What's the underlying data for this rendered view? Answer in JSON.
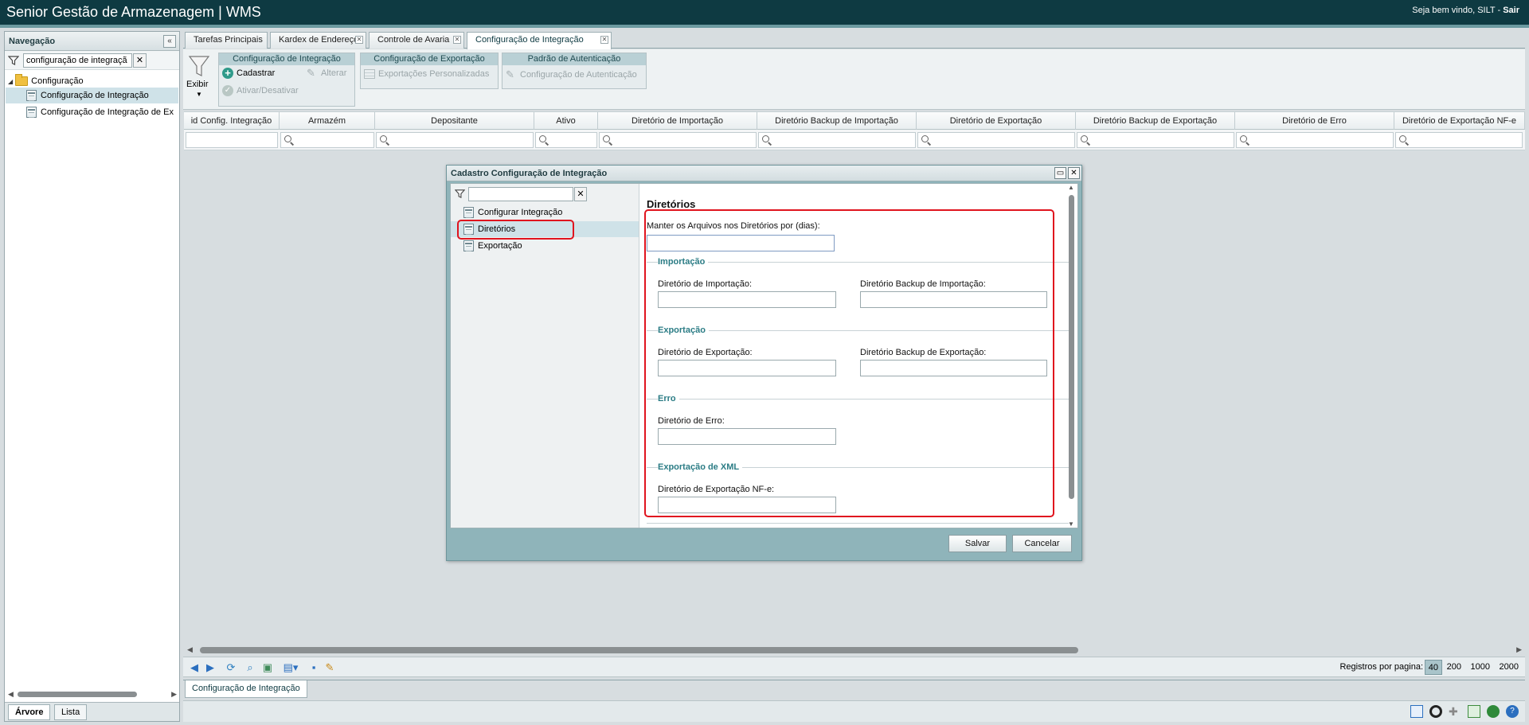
{
  "topbar": {
    "app_title": "Senior Gestão de Armazenagem | WMS",
    "welcome": "Seja bem vindo, SILT - ",
    "logout": "Sair"
  },
  "nav": {
    "title": "Navegação",
    "filter_value": "configuração de integraçã",
    "tree": {
      "root": "Configuração",
      "items": [
        "Configuração de Integração",
        "Configuração de Integração de Ex"
      ]
    },
    "bottom_tabs": [
      "Árvore",
      "Lista"
    ]
  },
  "tabs": [
    {
      "label": "Tarefas Principais",
      "closable": false
    },
    {
      "label": "Kardex de Endereço",
      "closable": true
    },
    {
      "label": "Controle de Avaria",
      "closable": true
    },
    {
      "label": "Configuração de Integração",
      "closable": true,
      "active": true
    }
  ],
  "ribbon": {
    "exibir": "Exibir",
    "groups": [
      {
        "title": "Configuração de Integração",
        "items": [
          "Cadastrar",
          "Alterar",
          "Ativar/Desativar"
        ]
      },
      {
        "title": "Configuração de Exportação",
        "items": [
          "Exportações Personalizadas"
        ]
      },
      {
        "title": "Padrão de Autenticação",
        "items": [
          "Configuração de Autenticação"
        ]
      }
    ]
  },
  "grid": {
    "columns": [
      "id Config. Integração",
      "Armazém",
      "Depositante",
      "Ativo",
      "Diretório de Importação",
      "Diretório Backup de Importação",
      "Diretório de Exportação",
      "Diretório Backup de Exportação",
      "Diretório de Erro",
      "Diretório de Exportação NF-e"
    ]
  },
  "footer": {
    "page_size_label": "Registros por pagina:",
    "page_sizes": [
      "40",
      "200",
      "1000",
      "2000"
    ],
    "active_page_size": "40",
    "bottom_tab": "Configuração de Integração"
  },
  "modal": {
    "title": "Cadastro Configuração de Integração",
    "tree": [
      "Configurar Integração",
      "Diretórios",
      "Exportação"
    ],
    "selected": "Diretórios",
    "section_title": "Diretórios",
    "keep_files_label": "Manter os Arquivos nos Diretórios por (dias):",
    "importacao": {
      "legend": "Importação",
      "dir_label": "Diretório de Importação:",
      "backup_label": "Diretório Backup de Importação:"
    },
    "exportacao": {
      "legend": "Exportação",
      "dir_label": "Diretório de Exportação:",
      "backup_label": "Diretório Backup de Exportação:"
    },
    "erro": {
      "legend": "Erro",
      "dir_label": "Diretório de Erro:"
    },
    "xml": {
      "legend": "Exportação de XML",
      "dir_label": "Diretório de Exportação NF-e:"
    },
    "save": "Salvar",
    "cancel": "Cancelar"
  },
  "colors": {
    "topbar": "#0e3a42",
    "highlight": "#e0141e",
    "legend": "#2b7c85"
  }
}
